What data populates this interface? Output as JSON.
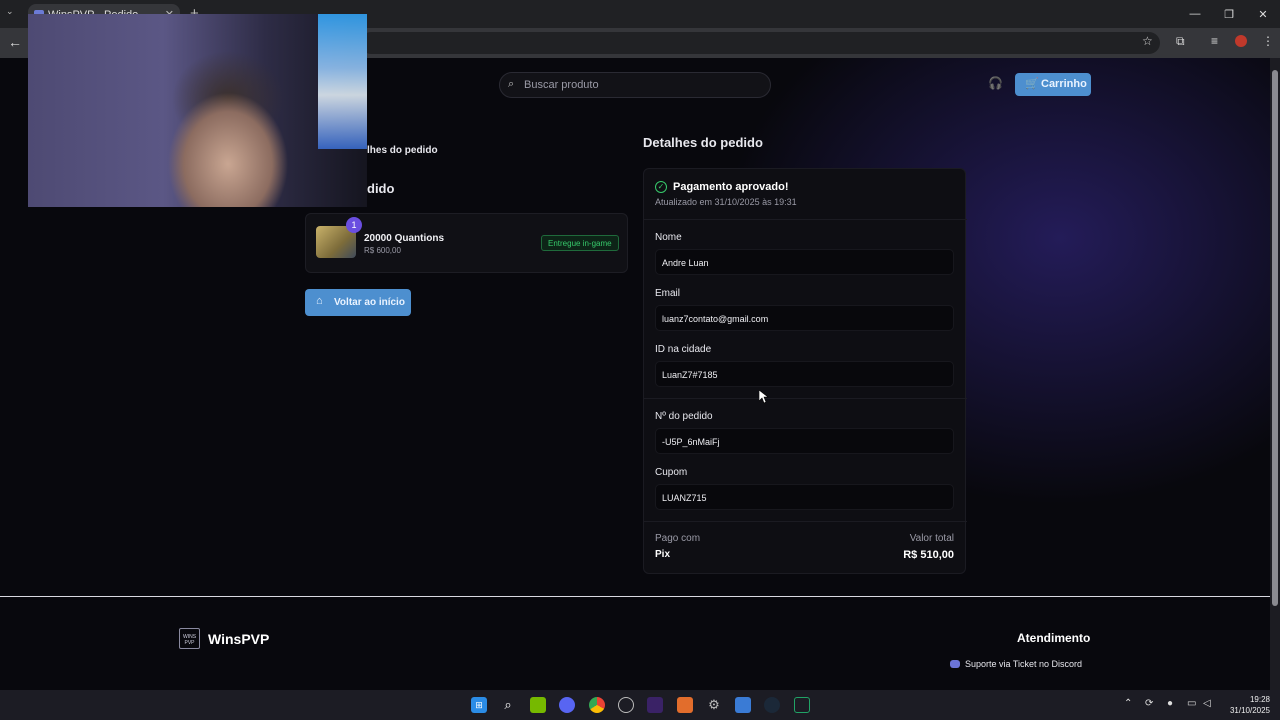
{
  "browser": {
    "tab_title": "WinsPVP - Pedido",
    "tab_close": "✕",
    "new_tab": "+"
  },
  "header": {
    "search_placeholder": "Buscar produto",
    "cart_label": "Carrinho"
  },
  "left": {
    "breadcrumb": "lhes do pedido",
    "title": "dido",
    "item": {
      "quantity": "1",
      "name": "20000 Quantions",
      "price": "R$ 600,00",
      "status": "Entregue in-game"
    },
    "home_button": "Voltar ao início"
  },
  "details": {
    "title": "Detalhes do pedido",
    "status_title": "Pagamento aprovado!",
    "status_updated": "Atualizado em 31/10/2025 às 19:31",
    "fields": [
      {
        "label": "Nome",
        "value": "Andre Luan"
      },
      {
        "label": "Email",
        "value": "luanz7contato@gmail.com"
      },
      {
        "label": "ID na cidade",
        "value": "LuanZ7#7185"
      },
      {
        "label": "Nº do pedido",
        "value": "-U5P_6nMaiFj"
      },
      {
        "label": "Cupom",
        "value": "LUANZ715"
      }
    ],
    "paid_with_label": "Pago com",
    "paid_with_value": "Pix",
    "total_label": "Valor total",
    "total_value": "R$ 510,00"
  },
  "footer": {
    "brand": "WinsPVP",
    "logo_text": "WINS PVP",
    "support_title": "Atendimento",
    "support_link": "Suporte via Ticket no Discord"
  },
  "taskbar": {
    "time": "19:28",
    "date": "31/10/2025"
  },
  "colors": {
    "accent_blue": "#4d8fcf",
    "success_green": "#37c96b",
    "badge_purple": "#6a4ee0"
  }
}
